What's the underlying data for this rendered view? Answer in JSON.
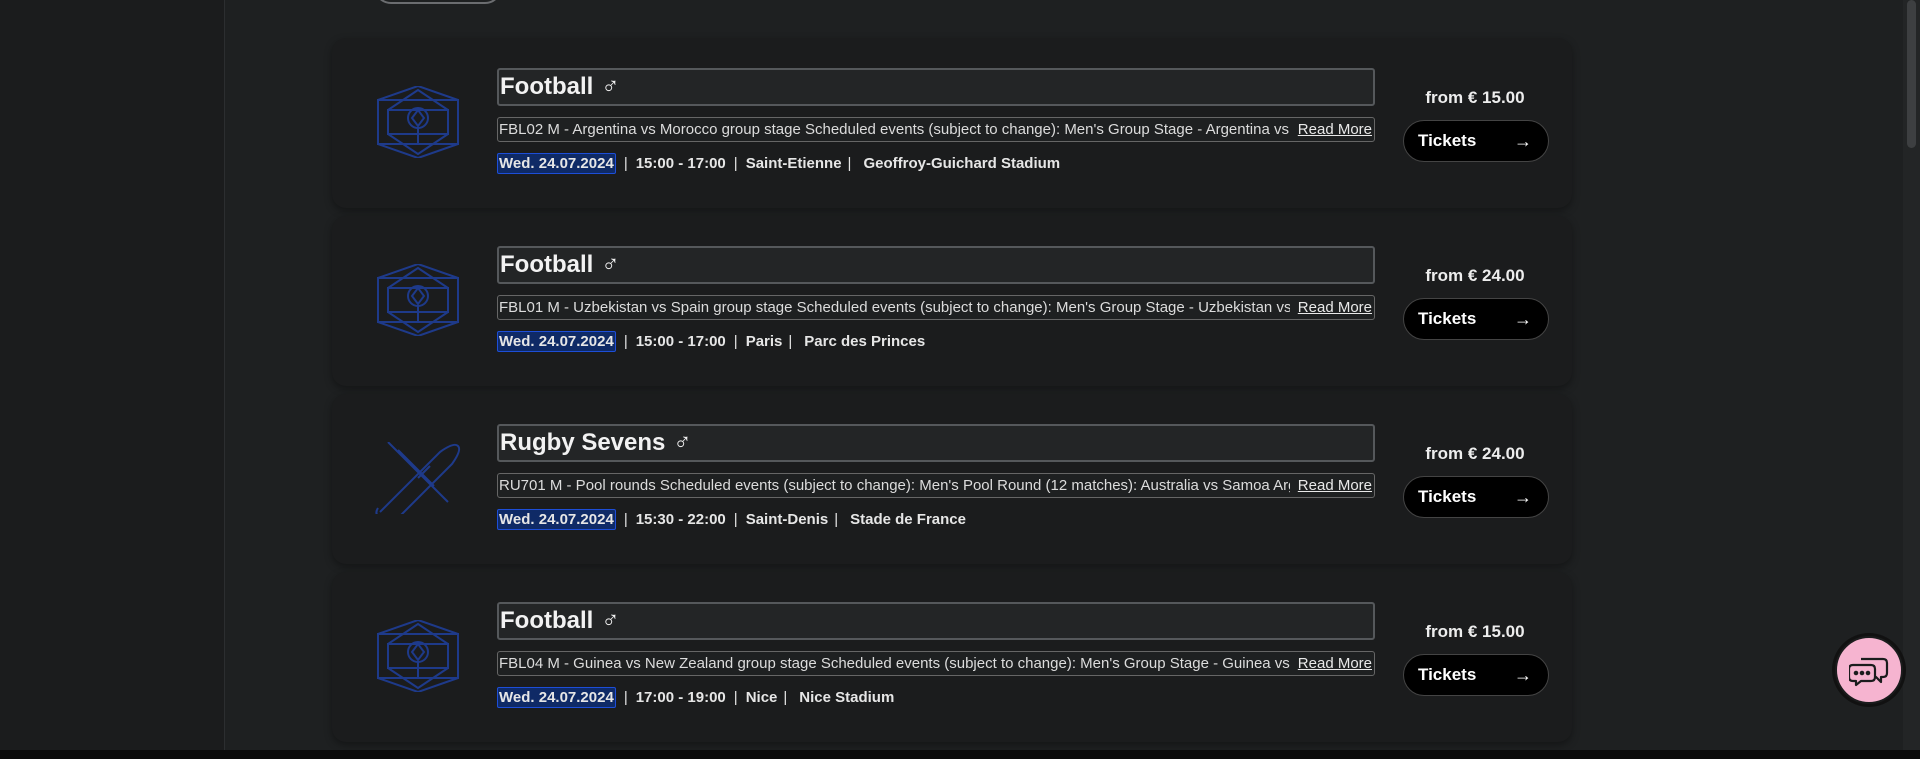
{
  "events": [
    {
      "sport": "Football",
      "pictogram": "football-pictogram-icon",
      "gender_icon": "♂",
      "description": "FBL02 M - Argentina vs Morocco group stage Scheduled events (subject to change): Men's Group Stage - Argentina vs Morocco",
      "read_more": "Read More",
      "date": "Wed. 24.07.2024",
      "time": "15:00 - 17:00",
      "city": "Saint-Etienne",
      "venue": "Geoffroy-Guichard Stadium",
      "price": "from € 15.00",
      "tickets_label": "Tickets"
    },
    {
      "sport": "Football",
      "pictogram": "football-pictogram-icon",
      "gender_icon": "♂",
      "description": "FBL01 M - Uzbekistan vs Spain group stage Scheduled events (subject to change): Men's Group Stage - Uzbekistan vs Spain",
      "read_more": "Read More",
      "date": "Wed. 24.07.2024",
      "time": "15:00 - 17:00",
      "city": "Paris",
      "venue": "Parc des Princes",
      "price": "from € 24.00",
      "tickets_label": "Tickets"
    },
    {
      "sport": "Rugby Sevens",
      "pictogram": "rugby-pictogram-icon",
      "gender_icon": "♂",
      "description": "RU701 M - Pool rounds Scheduled events (subject to change): Men's Pool Round (12 matches): Australia vs Samoa Argentina",
      "read_more": "Read More",
      "date": "Wed. 24.07.2024",
      "time": "15:30 - 22:00",
      "city": "Saint-Denis",
      "venue": "Stade de France",
      "price": "from € 24.00",
      "tickets_label": "Tickets"
    },
    {
      "sport": "Football",
      "pictogram": "football-pictogram-icon",
      "gender_icon": "♂",
      "description": "FBL04 M - Guinea vs New Zealand group stage Scheduled events (subject to change): Men's Group Stage - Guinea vs New Zealand",
      "read_more": "Read More",
      "date": "Wed. 24.07.2024",
      "time": "17:00 - 19:00",
      "city": "Nice",
      "venue": "Nice Stadium",
      "price": "from € 15.00",
      "tickets_label": "Tickets"
    }
  ],
  "chat": {
    "icon": "chat-bubbles-icon",
    "color": "#f6b4d0"
  },
  "colors": {
    "date_highlight": "#0f2a66",
    "pictogram": "#1e3a8a",
    "card": "#1b1c1d"
  }
}
